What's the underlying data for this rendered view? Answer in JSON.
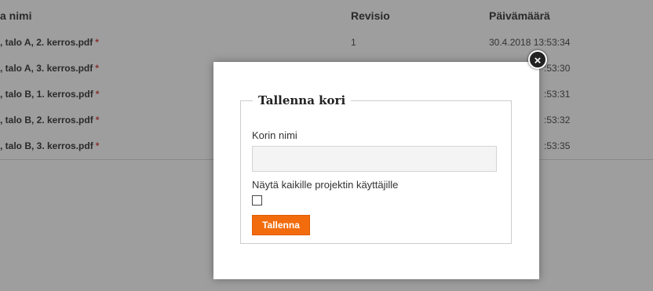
{
  "table": {
    "headers": {
      "name": "a nimi",
      "revision": "Revisio",
      "date": "Päivämäärä"
    },
    "rows": [
      {
        "name": ", talo A, 2. kerros.pdf",
        "revision": "1",
        "date": "30.4.2018 13:53:34"
      },
      {
        "name": ", talo A, 3. kerros.pdf",
        "revision": "",
        "date": ":53:30"
      },
      {
        "name": ", talo B, 1. kerros.pdf",
        "revision": "",
        "date": ":53:31"
      },
      {
        "name": ", talo B, 2. kerros.pdf",
        "revision": "",
        "date": ":53:32"
      },
      {
        "name": ", talo B, 3. kerros.pdf",
        "revision": "",
        "date": ":53:35"
      }
    ],
    "required_marker": "*"
  },
  "modal": {
    "close_symbol": "×",
    "legend": "Tallenna kori",
    "name_label": "Korin nimi",
    "name_value": "",
    "name_placeholder": "",
    "share_label": "Näytä kaikille projektin käyttäjille",
    "share_checked": false,
    "save_label": "Tallenna"
  },
  "colors": {
    "accent": "#f26c0d",
    "required": "#d9534f"
  }
}
